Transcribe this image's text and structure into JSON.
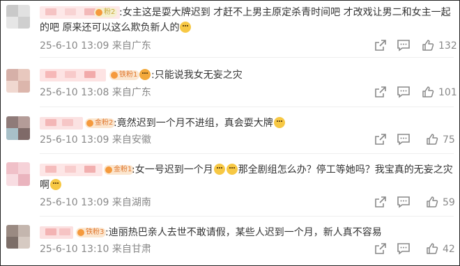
{
  "comments": [
    {
      "badge": "粉2",
      "line1": ":女主这是耍大牌迟到 才赶不上男主原定杀青时间吧 才改戏让男二和女主一起",
      "line2": "的吧 原来还可以这么欺负新人的",
      "emoji": "cry",
      "time": "25-6-10 13:09 来自广东",
      "likes": "132"
    },
    {
      "badge": "铁粉1",
      "line1": ":只能说我女无妄之灾",
      "emoji": "cheer",
      "time": "25-6-10 13:08 来自广东",
      "likes": "101"
    },
    {
      "badge": "金粉2",
      "line1": ":竟然迟到一个月不进组，真会耍大牌",
      "emoji": "shy",
      "time": "25-6-10 13:09 来自安徽",
      "likes": "75"
    },
    {
      "badge": "金粉1",
      "line1a": ":女一号迟到一个月",
      "line1b": "那全剧组怎么办？停工等她吗？我宝真的无妄之灾",
      "line2": "啊",
      "emoji": "cry",
      "time": "25-6-10 13:09 来自湖南",
      "likes": "59"
    },
    {
      "badge": "铁粉3",
      "line1": ":迪丽热巴亲人去世不敢请假，某些人迟到一个月，新人真不容易",
      "time": "25-6-10 13:10 来自甘肃",
      "likes": "42"
    }
  ],
  "icons": {
    "share": "share-icon",
    "comment": "comment-icon",
    "like": "thumbs-up-icon"
  }
}
